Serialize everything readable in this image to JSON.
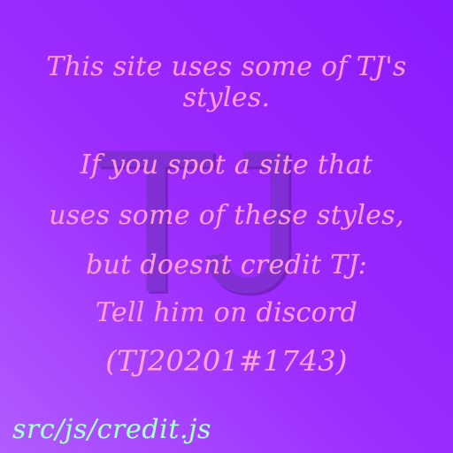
{
  "watermark": {
    "text": "TJ"
  },
  "intro": {
    "line": "This site uses some of TJ's styles."
  },
  "message": {
    "lines": [
      "If you spot a site that",
      "uses some of these styles,",
      "but doesnt credit TJ:",
      "Tell him on discord",
      "(TJ20201#1743)"
    ]
  },
  "footer": {
    "link": "src/js/credit.js"
  },
  "colors": {
    "background_top_right": "#8a1bff",
    "background_bottom_left": "#b05cff",
    "primary_text": "#ff9bd6",
    "footer_text": "#a8ffcf",
    "watermark": "#7a32c9"
  }
}
